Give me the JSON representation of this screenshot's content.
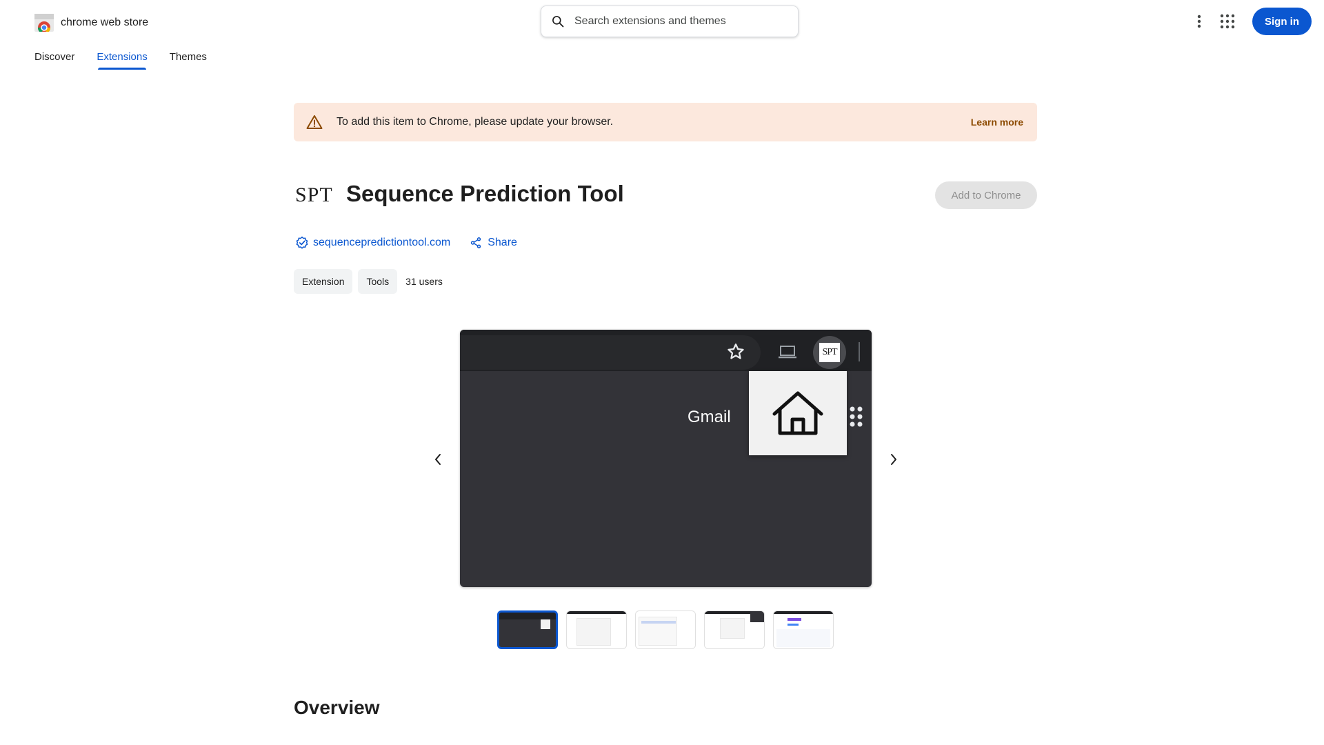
{
  "header": {
    "store_name": "chrome web store",
    "search_placeholder": "Search extensions and themes",
    "signin_label": "Sign in"
  },
  "nav": {
    "tabs": [
      {
        "label": "Discover",
        "active": false
      },
      {
        "label": "Extensions",
        "active": true
      },
      {
        "label": "Themes",
        "active": false
      }
    ]
  },
  "banner": {
    "message": "To add this item to Chrome, please update your browser.",
    "link_label": "Learn more"
  },
  "extension": {
    "logo_text": "SPT",
    "title": "Sequence Prediction Tool",
    "add_button_label": "Add to Chrome",
    "website": "sequencepredictiontool.com",
    "share_label": "Share",
    "chips": [
      "Extension",
      "Tools"
    ],
    "users": "31 users"
  },
  "carousel": {
    "slide_text": "Gmail",
    "slide_logo_text": "SPT",
    "thumbnail_count": 5,
    "active_index": 0
  },
  "sections": {
    "overview_title": "Overview"
  },
  "colors": {
    "primary": "#0b57d0",
    "banner_bg": "#fce8dd",
    "banner_link": "#8c4a00",
    "warning_icon": "#8c4a00"
  }
}
